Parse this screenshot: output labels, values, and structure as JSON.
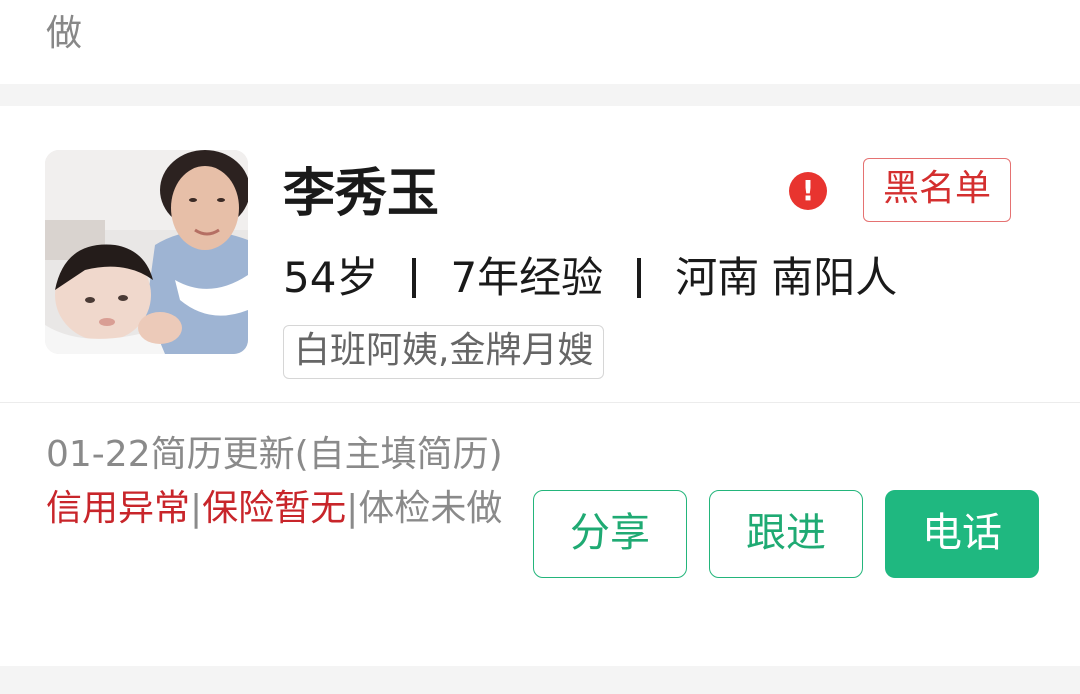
{
  "top_fragment": "做",
  "card": {
    "name": "李秀玉",
    "blacklist_label": "黑名单",
    "alert_icon": "!",
    "age": "54岁",
    "experience": "7年经验",
    "province": "河南",
    "city": "南阳人",
    "tags": "白班阿姨,金牌月嫂",
    "update_line": "01-22简历更新(自主填简历)",
    "credit": "信用异常",
    "insurance": "保险暂无",
    "checkup": "体检未做",
    "buttons": {
      "share": "分享",
      "follow": "跟进",
      "call": "电话"
    }
  },
  "colors": {
    "accent_green": "#1fb880",
    "alert_red": "#e8342f",
    "warning_text_red": "#c8252a"
  }
}
